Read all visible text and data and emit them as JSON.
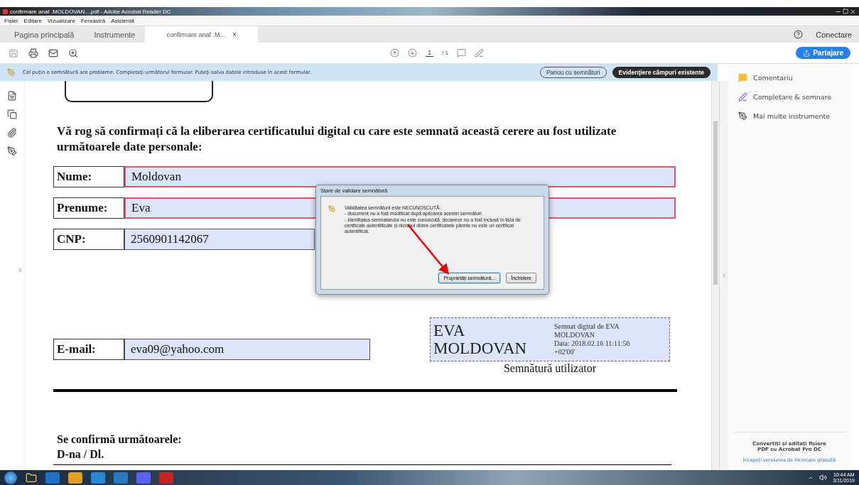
{
  "window": {
    "title": "confirmare anaf .MOLDOVAN....pdf - Adobe Acrobat Reader DC"
  },
  "menu": [
    "Fișier",
    "Editare",
    "Vizualizare",
    "Fereastră",
    "Asistență"
  ],
  "tabs": [
    {
      "label": "Pagina principală",
      "selected": false
    },
    {
      "label": "Instrumente",
      "selected": false
    },
    {
      "label": "confirmare anaf .M...",
      "selected": true,
      "close": "×"
    }
  ],
  "account": {
    "label": "Conectare"
  },
  "toolbar": {
    "page": "1",
    "total": "/ 1",
    "share": "Partajare"
  },
  "notice": {
    "text": "Cel puţin o semnătură are probleme.  Completaţi următorul formular. Puteţi salva datele introduse în acest formular.",
    "buttons": [
      {
        "label": "Panou cu semnături",
        "kind": "outline"
      },
      {
        "label": "Evidenţiere câmpuri existente",
        "kind": "dark"
      }
    ]
  },
  "document": {
    "heading": "Vă rog să confirmați că la eliberarea certificatului digital cu care este semnată această cerere au fost utilizate următoarele date personale:",
    "fields": [
      {
        "label": "Nume:",
        "value": "Moldovan",
        "invalid": true,
        "kind": "wide"
      },
      {
        "label": "Prenume:",
        "value": "Eva",
        "invalid": true,
        "kind": "wide"
      },
      {
        "label": "CNP:",
        "value": "2560901142067",
        "invalid": false,
        "kind": "short"
      }
    ],
    "email": {
      "label": "E-mail:",
      "value": "eva09@yahoo.com",
      "invalid": false
    },
    "signature": {
      "name": [
        "EVA",
        "MOLDOVAN"
      ],
      "details": [
        "Semnat digital de EVA",
        "MOLDOVAN",
        "Data: 2018.02.16 11:11:56",
        "+02'00'"
      ],
      "caption": "Semnătură utilizator"
    },
    "footer": [
      "Se confirmă următoarele:",
      "D-na / Dl."
    ]
  },
  "dialog": {
    "title": "Stare de validare semnătură",
    "message": [
      "Validitatea semnăturii este NECUNOSCUTĂ.",
      "- document nu a fost modificat după aplicarea acestei semnături.",
      "- Identitatea semnatarului nu este cunoscută, deoarece nu a fost inclusă în lista de certificate autentificate și niciunul dintre certificatele părinte nu este un certificat autentificat."
    ],
    "buttons": [
      {
        "label": "Proprietăți semnătură...",
        "selected": true
      },
      {
        "label": "Închidere",
        "selected": false
      }
    ]
  },
  "right_pane": {
    "tools": [
      {
        "label": "Comentariu",
        "kind": "comment",
        "color": "#f2c12e"
      },
      {
        "label": "Completare & semnare",
        "kind": "sign",
        "color": "#8a5cd6"
      },
      {
        "label": "Mai multe instrumente",
        "kind": "more",
        "color": "#555555"
      }
    ],
    "promo": "Convertiți și editați fișiere PDF cu Acrobat Pro DC",
    "link": "Începeți versiunea de încercare gratuită"
  },
  "taskbar": {
    "time": "10:44 AM",
    "date": "3/11/2019"
  }
}
